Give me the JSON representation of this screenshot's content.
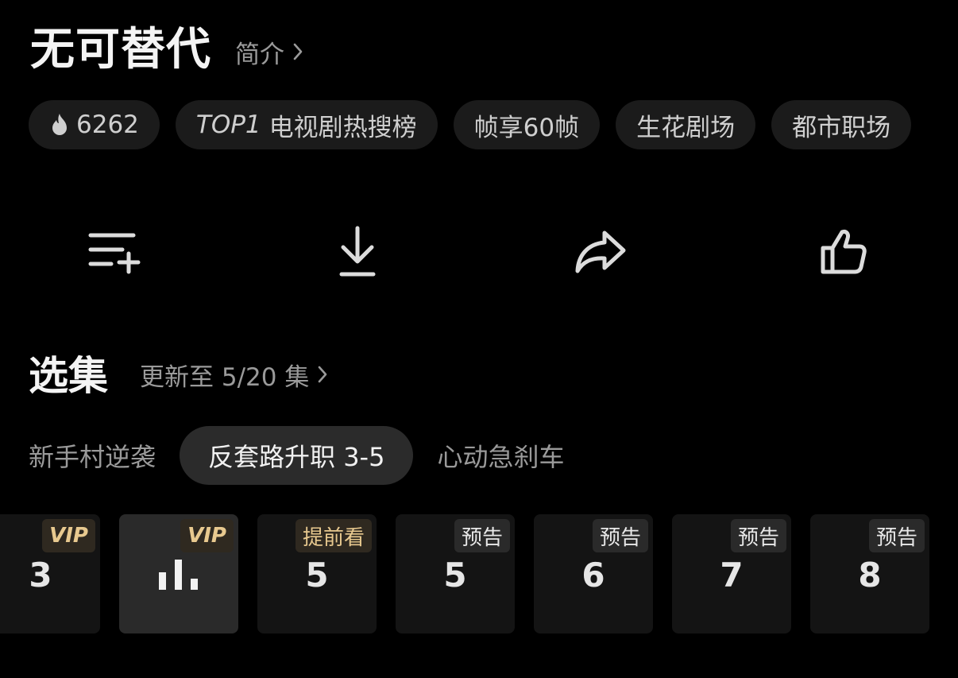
{
  "header": {
    "title": "无可替代",
    "intro_label": "简介"
  },
  "tags": [
    {
      "text": "6262",
      "icon": "fire-icon"
    },
    {
      "prefix": "TOP1",
      "text": "电视剧热搜榜"
    },
    {
      "text": "帧享60帧"
    },
    {
      "text": "生花剧场"
    },
    {
      "text": "都市职场"
    }
  ],
  "actions": [
    {
      "icon": "add-to-playlist-icon"
    },
    {
      "icon": "download-icon"
    },
    {
      "icon": "share-icon"
    },
    {
      "icon": "thumbs-up-icon"
    }
  ],
  "episodes": {
    "title": "选集",
    "update_label": "更新至 5/20 集",
    "segments": [
      {
        "label": "新手村逆袭",
        "active": false
      },
      {
        "label": "反套路升职 3-5",
        "active": true
      },
      {
        "label": "心动急刹车",
        "active": false
      }
    ],
    "cards": [
      {
        "number": "3",
        "badge": "VIP",
        "badge_type": "vip"
      },
      {
        "number": "",
        "badge": "VIP",
        "badge_type": "vip",
        "playing": true,
        "icon": "playing-bars-icon"
      },
      {
        "number": "5",
        "badge": "提前看",
        "badge_type": "early"
      },
      {
        "number": "5",
        "badge": "预告",
        "badge_type": "preview"
      },
      {
        "number": "6",
        "badge": "预告",
        "badge_type": "preview"
      },
      {
        "number": "7",
        "badge": "预告",
        "badge_type": "preview"
      },
      {
        "number": "8",
        "badge": "预告",
        "badge_type": "preview"
      }
    ]
  },
  "colors": {
    "background": "#000000",
    "tag_bg": "#1b1b1b",
    "vip_gold": "#e8c98f",
    "muted_text": "#9a9a9a"
  }
}
